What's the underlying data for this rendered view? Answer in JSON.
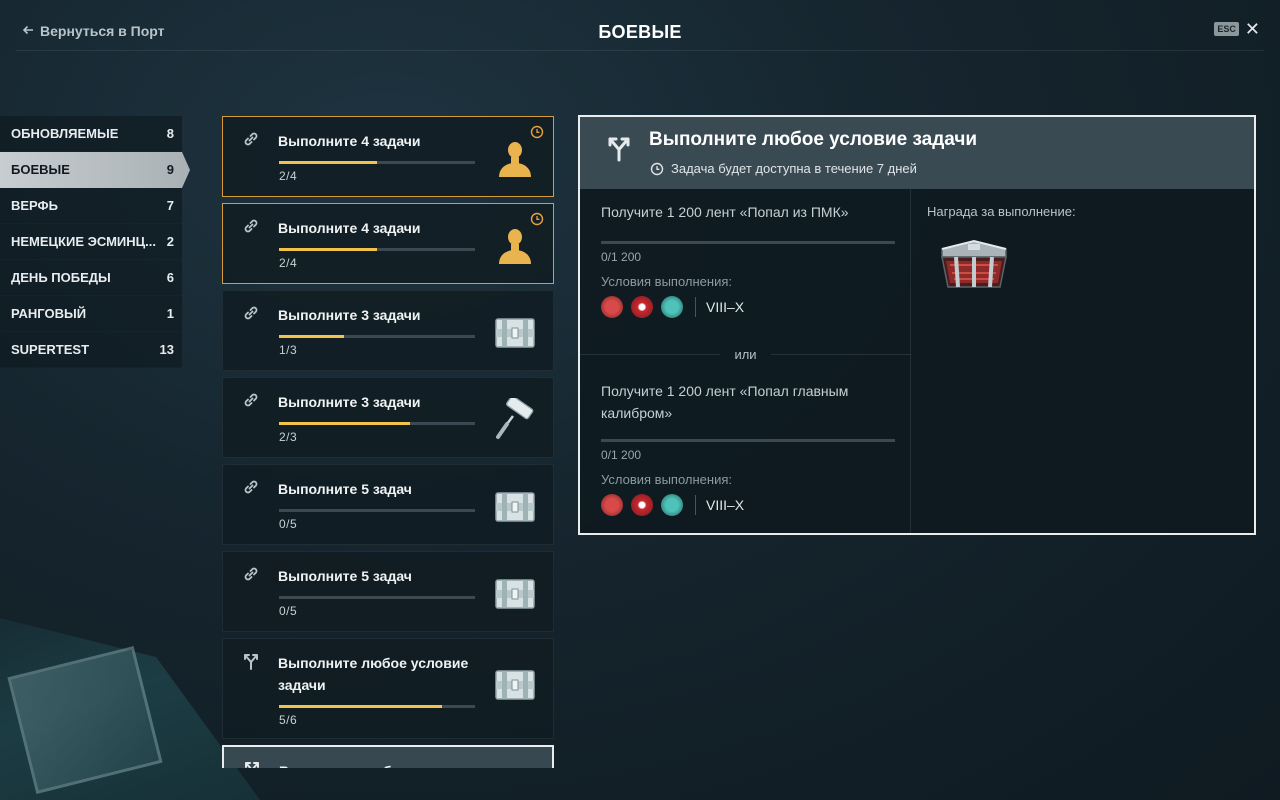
{
  "header": {
    "back_label": "Вернуться в Порт",
    "title": "БОЕВЫЕ",
    "esc_label": "ESC"
  },
  "sidebar": {
    "items": [
      {
        "label": "ОБНОВЛЯЕМЫЕ",
        "count": "8"
      },
      {
        "label": "БОЕВЫЕ",
        "count": "9",
        "active": true
      },
      {
        "label": "ВЕРФЬ",
        "count": "7"
      },
      {
        "label": "НЕМЕЦКИЕ ЭСМИНЦ...",
        "count": "2"
      },
      {
        "label": "ДЕНЬ ПОБЕДЫ",
        "count": "6"
      },
      {
        "label": "РАНГОВЫЙ",
        "count": "1"
      },
      {
        "label": "SUPERTEST",
        "count": "13"
      }
    ]
  },
  "tasks": [
    {
      "title": "Выполните 4 задачи",
      "count": "2/4",
      "progress": 0.5,
      "icon": "chain-link-icon",
      "reward": "commander-reward-icon",
      "timed": true
    },
    {
      "title": "Выполните 4 задачи",
      "count": "2/4",
      "progress": 0.5,
      "icon": "chain-link-icon",
      "reward": "commander-reward-icon",
      "timed": true
    },
    {
      "title": "Выполните 3 задачи",
      "count": "1/3",
      "progress": 0.333,
      "icon": "chain-link-icon",
      "reward": "container-reward-icon"
    },
    {
      "title": "Выполните 3 задачи",
      "count": "2/3",
      "progress": 0.667,
      "icon": "chain-link-icon",
      "reward": "paint-roller-reward-icon"
    },
    {
      "title": "Выполните 5 задач",
      "count": "0/5",
      "progress": 0,
      "icon": "chain-link-icon",
      "reward": "container-reward-icon"
    },
    {
      "title": "Выполните 5 задач",
      "count": "0/5",
      "progress": 0,
      "icon": "chain-link-icon",
      "reward": "container-reward-icon"
    },
    {
      "title": "Выполните любое условие задачи",
      "count": "5/6",
      "progress": 0.833,
      "icon": "branch-icon",
      "reward": "container-reward-icon"
    },
    {
      "title": "Выполните любое условие",
      "count": "",
      "progress": 0,
      "icon": "branch-icon",
      "reward": "",
      "selected": true
    }
  ],
  "detail": {
    "title": "Выполните любое условие задачи",
    "subtitle": "Задача будет доступна в течение 7 дней",
    "conditions": [
      {
        "text": "Получите 1 200 лент «Попал из ПМК»",
        "count": "0/1 200",
        "progress": 0,
        "label": "Условия выполнения:",
        "tiers": "VIII–X"
      },
      {
        "text": "Получите 1 200 лент «Попал главным калибром»",
        "count": "0/1 200",
        "progress": 0,
        "label": "Условия выполнения:",
        "tiers": "VIII–X"
      }
    ],
    "or_label": "или",
    "reward_label": "Награда за выполнение:",
    "reward_icon": "supercontainer-reward-icon"
  },
  "colors": {
    "accent_highlight": "#d89a3a",
    "progress_fill": "#f3c24a"
  }
}
